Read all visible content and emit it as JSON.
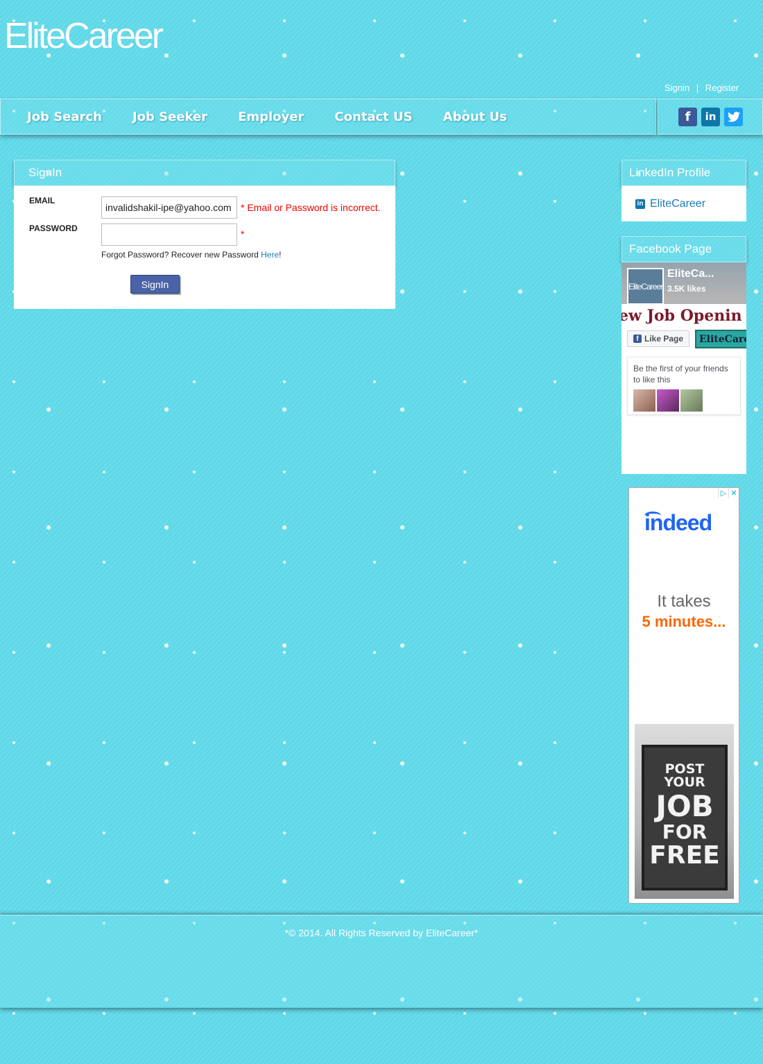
{
  "site": {
    "logo": "EliteCareer"
  },
  "auth": {
    "signin": "Signin",
    "separator": "|",
    "register": "Register"
  },
  "nav": {
    "items": [
      "Job Search",
      "Job Seeker",
      "Employer",
      "Contact US",
      "About Us"
    ]
  },
  "social": {
    "facebook": "f",
    "linkedin": "in",
    "twitter": "t"
  },
  "signin_panel": {
    "title": "SignIn",
    "email_label": "EMAIL",
    "email_value": "invalidshakil-ipe@yahoo.com",
    "email_error": "* Email or Password is incorrect.",
    "password_label": "PASSWORD",
    "password_value": "",
    "password_error": "*",
    "forgot_text": "Forgot Password? Recover new Password ",
    "forgot_link": "Here",
    "forgot_suffix": "!",
    "button": "SignIn"
  },
  "linkedin_panel": {
    "title": "LinkedIn Profile",
    "link": "EliteCareer",
    "mini_icon": "in"
  },
  "facebook_panel": {
    "title": "Facebook Page",
    "page_name": "EliteCa...",
    "likes": "3.5K likes",
    "thumb_text": "EliteCareer",
    "banner_text": "ew Job Openin",
    "like_button": "Like Page",
    "mini_logo": "EliteCareer",
    "friends_text": "Be the first of your friends to like this"
  },
  "ad": {
    "brand": "indeed",
    "line1": "It takes",
    "line2": "5 minutes...",
    "board": [
      "POST YOUR",
      "JOB",
      "FOR",
      "FREE"
    ],
    "icons": [
      "▷",
      "✕"
    ]
  },
  "footer": {
    "text": "*© 2014. All Rights Reserved by EliteCareer*"
  },
  "colors": {
    "background": "#5ed8e8",
    "button": "#4a63a8",
    "error": "#ee0000",
    "link": "#1b7bb5"
  }
}
